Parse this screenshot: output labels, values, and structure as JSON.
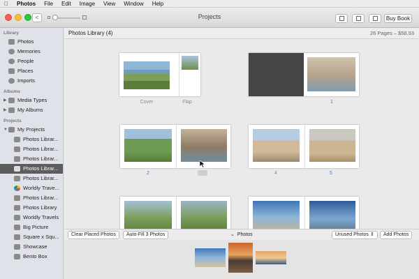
{
  "menubar": {
    "apple": "",
    "app": "Photos",
    "items": [
      "File",
      "Edit",
      "Image",
      "View",
      "Window",
      "Help"
    ]
  },
  "window": {
    "title": "Projects",
    "back_glyph": "<",
    "buy_label": "Buy Book"
  },
  "sidebar": {
    "library_header": "Library",
    "library": [
      "Photos",
      "Memories",
      "People",
      "Places",
      "Imports"
    ],
    "albums_header": "Albums",
    "albums": [
      "Media Types",
      "My Albums"
    ],
    "projects_header": "Projects",
    "projects_root": "My Projects",
    "projects": [
      "Photos Librar...",
      "Photos Librar...",
      "Photos Librar...",
      "Photos Librar...",
      "Photos Librar...",
      "Worldly Trave...",
      "Photos Librar...",
      "Photos Library",
      "Worldly Travels",
      "Big Picture",
      "Square x Squ...",
      "Showcase",
      "Bento Box"
    ],
    "selected_index": 3
  },
  "main": {
    "title": "Photos Library (4)",
    "summary": "26 Pages – $58.93",
    "labels": {
      "cover": "Cover",
      "flap": "Flap",
      "s1": "1",
      "s2": "2",
      "s4": "4",
      "s5": "5"
    }
  },
  "tray": {
    "clear_label": "Clear Placed Photos",
    "autofill_label": "Auto-Fill 3 Photos",
    "title": "Photos",
    "chevron": "⌄",
    "filter_label": "Unused Photos",
    "add_label": "Add Photos"
  },
  "colors": {
    "selected": "#5d5d5d",
    "link": "#3a7bd5",
    "sidebar_bg": "#dfe3e9"
  }
}
